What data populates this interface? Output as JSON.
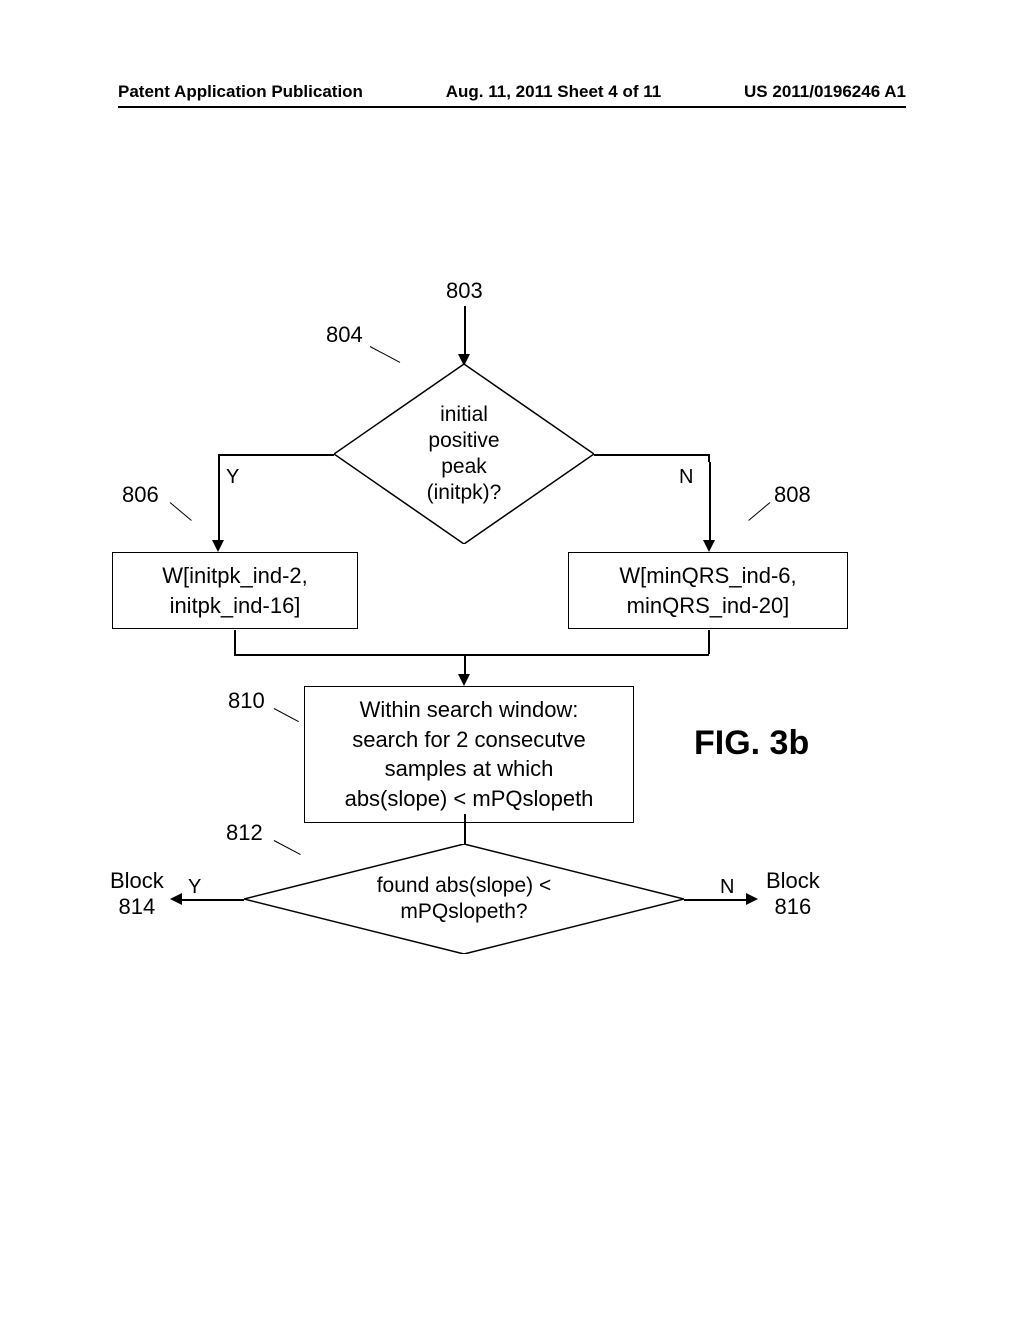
{
  "header": {
    "left": "Patent Application Publication",
    "center": "Aug. 11, 2011  Sheet 4 of 11",
    "right": "US 2011/0196246 A1"
  },
  "refs": {
    "r803": "803",
    "r804": "804",
    "r806": "806",
    "r808": "808",
    "r810": "810",
    "r812": "812"
  },
  "labels": {
    "yes": "Y",
    "no": "N",
    "block_left": "Block\n814",
    "block_right": "Block\n816"
  },
  "nodes": {
    "d1": "initial\npositive\npeak\n(initpk)?",
    "b806": "W[initpk_ind-2,\ninitpk_ind-16]",
    "b808": "W[minQRS_ind-6,\nminQRS_ind-20]",
    "b810": "Within search window:\nsearch for 2 consecutve\nsamples at which\nabs(slope) < mPQslopeth",
    "d2": "found abs(slope) <\nmPQslopeth?"
  },
  "figure": {
    "title": "FIG. 3b"
  }
}
